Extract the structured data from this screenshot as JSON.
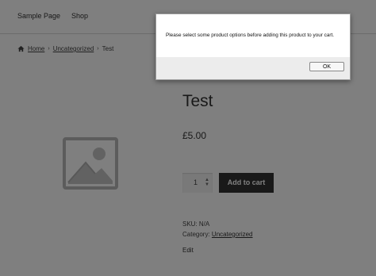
{
  "nav": {
    "items": [
      {
        "label": "Sample Page"
      },
      {
        "label": "Shop"
      }
    ]
  },
  "breadcrumb": {
    "home": "Home",
    "category": "Uncategorized",
    "current": "Test",
    "separator": "›"
  },
  "product": {
    "title": "Test",
    "price": "£5.00",
    "quantity": "1",
    "add_to_cart": "Add to cart",
    "sku_text": "SKU: N/A",
    "category_label": "Category:",
    "category": "Uncategorized",
    "edit": "Edit",
    "image_icon": "image-placeholder-icon"
  },
  "dialog": {
    "message": "Please select some product options before adding this product to your cart.",
    "ok_label": "OK"
  },
  "colors": {
    "overlay": "rgba(0,0,0,0.5)",
    "button_dark": "#333333"
  }
}
